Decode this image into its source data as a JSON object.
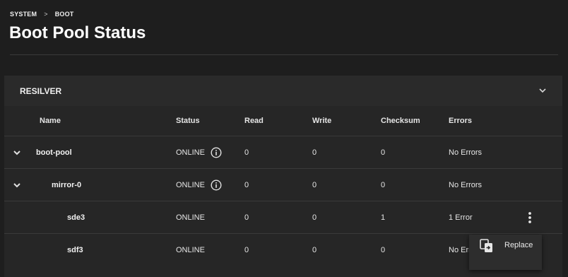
{
  "breadcrumb": {
    "items": [
      "SYSTEM",
      "BOOT"
    ],
    "separator": ">"
  },
  "page": {
    "title": "Boot Pool Status"
  },
  "card": {
    "title": "RESILVER"
  },
  "table": {
    "headers": {
      "name": "Name",
      "status": "Status",
      "read": "Read",
      "write": "Write",
      "checksum": "Checksum",
      "errors": "Errors"
    },
    "rows": [
      {
        "name": "boot-pool",
        "status": "ONLINE",
        "read": "0",
        "write": "0",
        "checksum": "0",
        "errors": "No Errors"
      },
      {
        "name": "mirror-0",
        "status": "ONLINE",
        "read": "0",
        "write": "0",
        "checksum": "0",
        "errors": "No Errors"
      },
      {
        "name": "sde3",
        "status": "ONLINE",
        "read": "0",
        "write": "0",
        "checksum": "1",
        "errors": "1 Error"
      },
      {
        "name": "sdf3",
        "status": "ONLINE",
        "read": "0",
        "write": "0",
        "checksum": "0",
        "errors": "No Errors"
      }
    ]
  },
  "context_menu": {
    "items": [
      {
        "label": "Replace",
        "icon": "replace-icon"
      }
    ]
  },
  "colors": {
    "background": "#1e1e1e",
    "card": "#262626",
    "text": "#e6e6e6"
  }
}
